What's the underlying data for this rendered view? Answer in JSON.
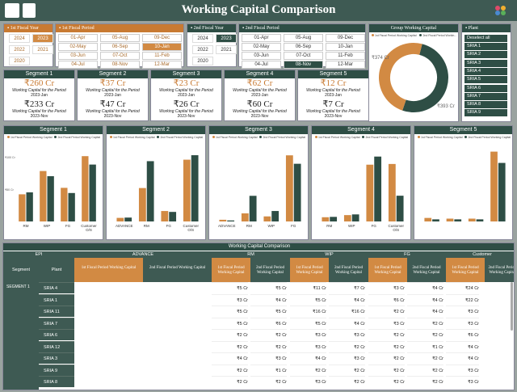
{
  "header": {
    "title": "Working Capital Comparison"
  },
  "fy1": {
    "title": "1st Fiscal Year",
    "years": [
      "2024",
      "2023",
      "2022",
      "2021",
      "2020"
    ],
    "selected": "2023"
  },
  "fp1": {
    "title": "1st Fiscal Period",
    "months": [
      "01-Apr",
      "02-May",
      "03-Jun",
      "04-Jul",
      "05-Aug",
      "06-Sep",
      "07-Oct",
      "08-Nov",
      "09-Dec",
      "10-Jan",
      "11-Feb",
      "12-Mar"
    ],
    "selected": "10-Jan"
  },
  "fy2": {
    "title": "2nd Fiscal Year",
    "years": [
      "2024",
      "2023",
      "2022",
      "2021",
      "2020"
    ],
    "selected": "2023"
  },
  "fp2": {
    "title": "2nd Fiscal Period",
    "months": [
      "01-Apr",
      "02-May",
      "03-Jun",
      "04-Jul",
      "05-Aug",
      "06-Sep",
      "07-Oct",
      "08-Nov",
      "09-Dec",
      "10-Jan",
      "11-Feb",
      "12-Mar"
    ],
    "selected": "08-Nov"
  },
  "donut": {
    "title": "Group Working Capital",
    "legend1": "1st Fiscal Period Working Capital",
    "legend2": "2nd Fiscal Period Workin...",
    "v1": "₹374 Cr",
    "v2": "₹393 Cr",
    "val1": 374,
    "val2": 393,
    "color1": "#d28a43",
    "color2": "#2e4e45"
  },
  "plant": {
    "title": "Plant",
    "deselect": "Deselect all",
    "items": [
      "SRIA 1",
      "SRIA 2",
      "SRIA 3",
      "SRIA 4",
      "SRIA 5",
      "SRIA 6",
      "SRIA 7",
      "SRIA 8",
      "SRIA 9"
    ]
  },
  "cards": [
    {
      "title": "Segment 1",
      "v1": "₹260 Cr",
      "d1": "2023-Jan",
      "v2": "₹233 Cr",
      "d2": "2023-Nov"
    },
    {
      "title": "Segment 2",
      "v1": "₹37 Cr",
      "d1": "2023-Jan",
      "v2": "₹47 Cr",
      "d2": "2023-Nov"
    },
    {
      "title": "Segment 3",
      "v1": "₹23 Cr",
      "d1": "2023-Jan",
      "v2": "₹26 Cr",
      "d2": "2023-Nov"
    },
    {
      "title": "Segment 4",
      "v1": "₹62 Cr",
      "d1": "2023-Jan",
      "v2": "₹60 Cr",
      "d2": "2023-Nov"
    },
    {
      "title": "Segment 5",
      "v1": "₹12 Cr",
      "d1": "2023-Jan",
      "v2": "₹7 Cr",
      "d2": "2023-Nov"
    }
  ],
  "card_sub": "Working Capital for the Period",
  "chart_legend": {
    "a": "1st Fiscal Period Working Capital",
    "b": "2nd Fiscal Period Working Capital"
  },
  "chart_data": [
    {
      "type": "bar",
      "title": "Segment 1",
      "categories": [
        "RM",
        "WIP",
        "FG",
        "Customer O/S"
      ],
      "series": [
        {
          "name": "1st Fiscal Period Working Capital",
          "values": [
            42,
            78,
            52,
            101
          ]
        },
        {
          "name": "2nd Fiscal Period Working Capital",
          "values": [
            45,
            70,
            44,
            88
          ]
        }
      ],
      "ylabels": [
        "₹100 Cr",
        "₹50 Cr"
      ],
      "ylim": [
        0,
        120
      ]
    },
    {
      "type": "bar",
      "title": "Segment 2",
      "categories": [
        "ADVANCE",
        "RM",
        "FG",
        "Customer O/S"
      ],
      "series": [
        {
          "name": "1st Fiscal Period Working Capital",
          "values": [
            1.2,
            11.2,
            3.5,
            20.7
          ]
        },
        {
          "name": "2nd Fiscal Period Working Capital",
          "values": [
            1.3,
            20.2,
            3.2,
            22.2
          ]
        }
      ],
      "ylim": [
        0,
        26
      ]
    },
    {
      "type": "bar",
      "title": "Segment 3",
      "categories": [
        "ADVANCE",
        "RM",
        "WIP",
        "FG"
      ],
      "series": [
        {
          "name": "1st Fiscal Period Working Capital",
          "values": [
            0.5,
            2.4,
            1.5,
            19.6
          ]
        },
        {
          "name": "2nd Fiscal Period Working Capital",
          "values": [
            0.3,
            7.6,
            3.1,
            17.1
          ]
        }
      ],
      "ylim": [
        0,
        23
      ]
    },
    {
      "type": "bar",
      "title": "Segment 4",
      "categories": [
        "RM",
        "WIP",
        "FG",
        "Customer O/S"
      ],
      "series": [
        {
          "name": "1st Fiscal Period Working Capital",
          "values": [
            1.2,
            1.8,
            16.1,
            16.3
          ]
        },
        {
          "name": "2nd Fiscal Period Working Capital",
          "values": [
            1.3,
            2.0,
            18.4,
            7.3
          ]
        }
      ],
      "ylim": [
        0,
        22
      ]
    },
    {
      "type": "bar",
      "title": "Segment 5",
      "categories": [
        "",
        "",
        "",
        ""
      ],
      "series": [
        {
          "name": "1st Fiscal Period Working Capital",
          "values": [
            0.5,
            0.4,
            0.4,
            9.9
          ]
        },
        {
          "name": "2nd Fiscal Period Working Capital",
          "values": [
            0.3,
            0.3,
            0.3,
            8.3
          ]
        }
      ],
      "ylim": [
        0,
        11
      ]
    }
  ],
  "table": {
    "title": "Working Capital Comparison",
    "h_epi": "EPI",
    "h_segment": "Segment",
    "h_plant": "Plant",
    "groups": [
      "ADVANCE",
      "RM",
      "WIP",
      "FG",
      "Customer"
    ],
    "sub1": "1st Fiscal Period Working Capital",
    "sub2": "2nd Fiscal Period Working Capital",
    "seg": "SEGMENT 1",
    "rows": [
      {
        "plant": "SRIA 4",
        "v": [
          "₹5 Cr",
          "₹5 Cr",
          "₹11 Cr",
          "₹7 Cr",
          "₹3 Cr",
          "₹4 Cr",
          "₹24 Cr"
        ]
      },
      {
        "plant": "SRIA 1",
        "v": [
          "₹3 Cr",
          "₹4 Cr",
          "₹5 Cr",
          "₹4 Cr",
          "₹6 Cr",
          "₹4 Cr",
          "₹22 Cr"
        ]
      },
      {
        "plant": "SRIA 11",
        "v": [
          "₹5 Cr",
          "₹5 Cr",
          "₹16 Cr",
          "₹16 Cr",
          "₹2 Cr",
          "₹4 Cr",
          "₹3 Cr"
        ]
      },
      {
        "plant": "SRIA 7",
        "v": [
          "₹5 Cr",
          "₹6 Cr",
          "₹5 Cr",
          "₹4 Cr",
          "₹3 Cr",
          "₹2 Cr",
          "₹3 Cr"
        ]
      },
      {
        "plant": "SRIA 6",
        "v": [
          "₹2 Cr",
          "₹2 Cr",
          "₹3 Cr",
          "₹3 Cr",
          "₹2 Cr",
          "₹2 Cr",
          "₹6 Cr"
        ]
      },
      {
        "plant": "SRIA 12",
        "v": [
          "₹2 Cr",
          "₹2 Cr",
          "₹3 Cr",
          "₹2 Cr",
          "₹2 Cr",
          "₹1 Cr",
          "₹4 Cr"
        ]
      },
      {
        "plant": "SRIA 3",
        "v": [
          "₹4 Cr",
          "₹3 Cr",
          "₹4 Cr",
          "₹3 Cr",
          "₹2 Cr",
          "₹2 Cr",
          "₹4 Cr"
        ]
      },
      {
        "plant": "SRIA 9",
        "v": [
          "₹2 Cr",
          "₹1 Cr",
          "₹2 Cr",
          "₹2 Cr",
          "₹2 Cr",
          "₹2 Cr",
          "₹3 Cr"
        ]
      },
      {
        "plant": "SRIA 8",
        "v": [
          "₹2 Cr",
          "₹2 Cr",
          "₹3 Cr",
          "₹2 Cr",
          "₹2 Cr",
          "₹2 Cr",
          "₹3 Cr"
        ]
      }
    ]
  }
}
